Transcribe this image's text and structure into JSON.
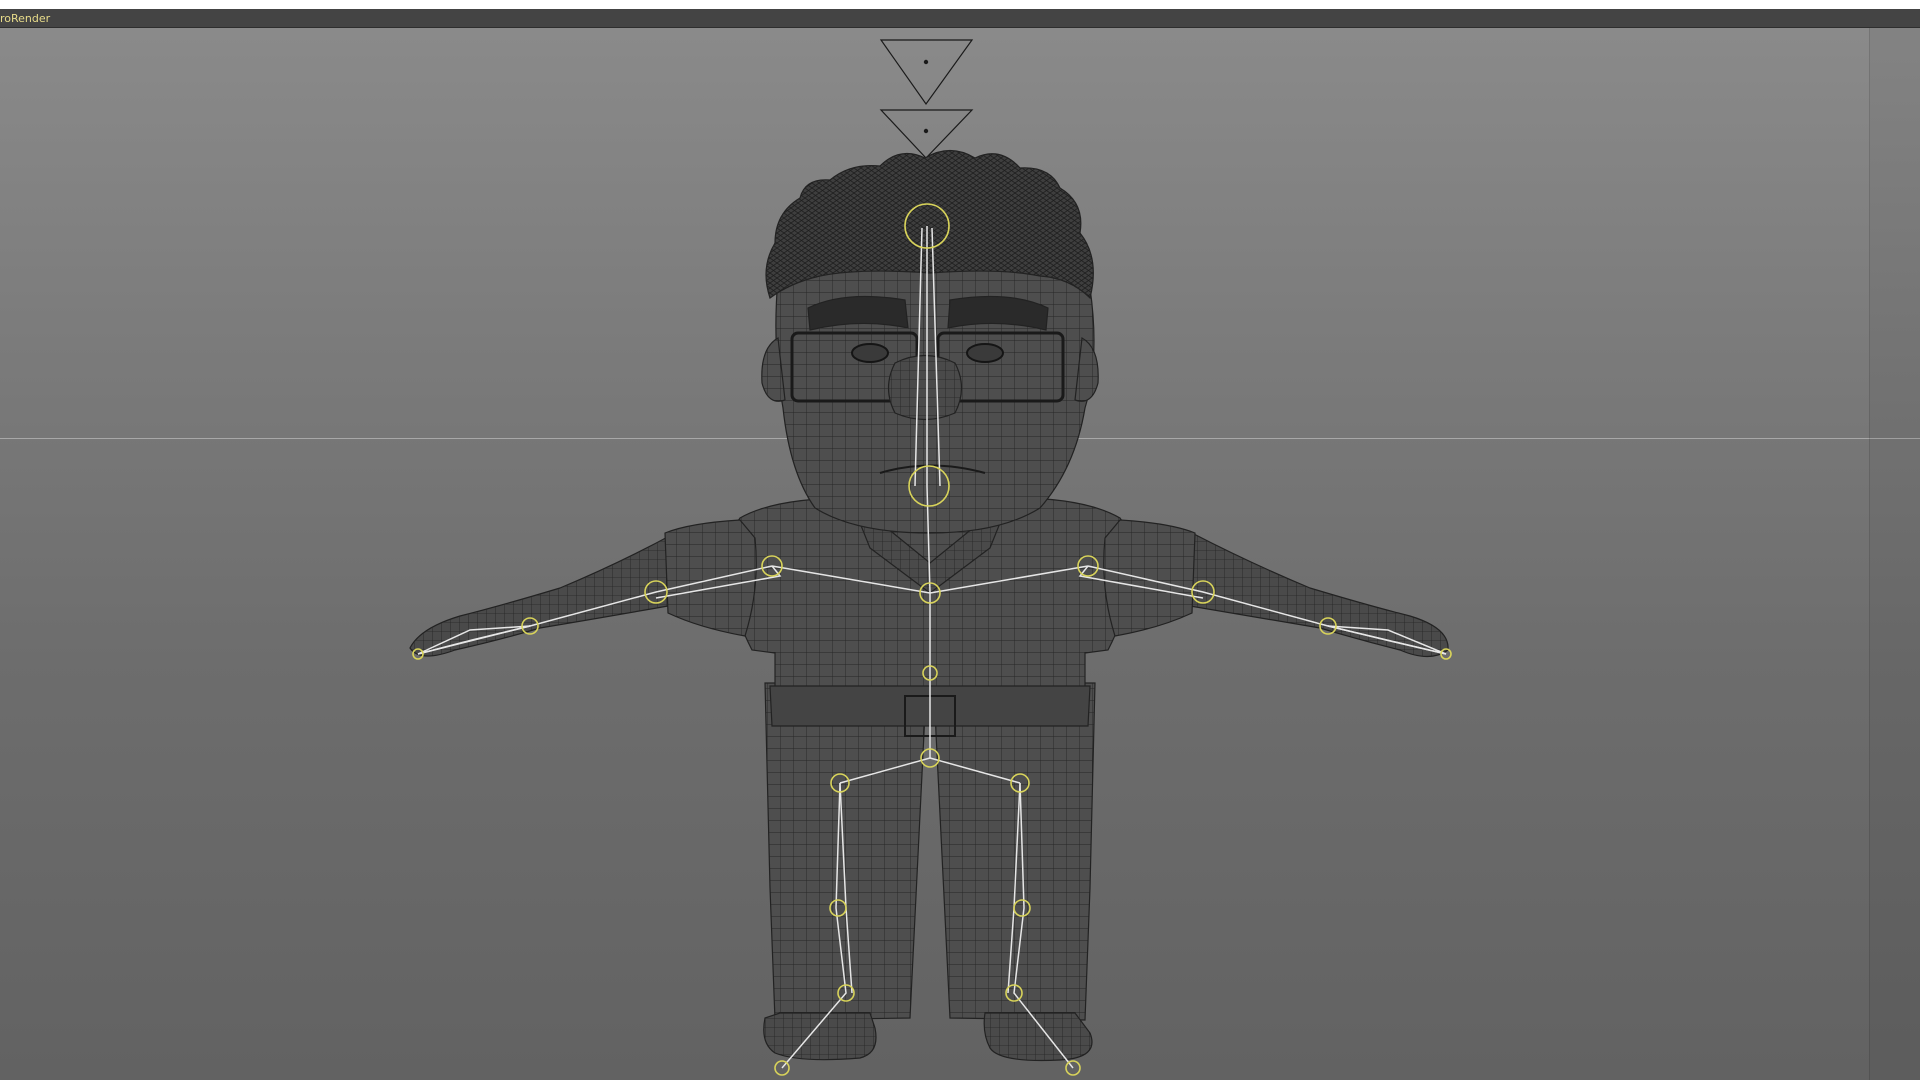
{
  "app": {
    "panel_label": "roRender"
  },
  "viewport": {
    "view": "front",
    "shading": "wireframe-on-shaded",
    "colors": {
      "background_top": "#8a8a8a",
      "background_bottom": "#626262",
      "mesh_fill": "#4e4e4e",
      "wire": "#262626",
      "joint": "#d8d35a",
      "bone": "#e6e6e6",
      "camera": "#1a1a1a",
      "label": "#e8dc8a"
    }
  }
}
